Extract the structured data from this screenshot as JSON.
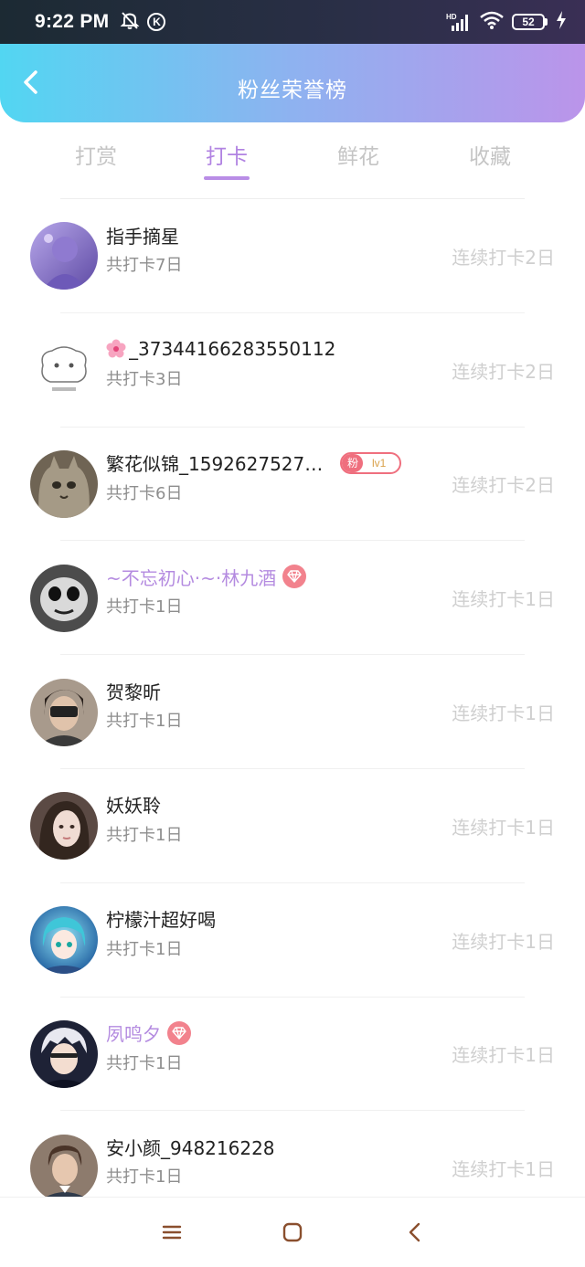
{
  "status_bar": {
    "time": "9:22 PM",
    "k_badge": "K",
    "network_label": "HD",
    "battery": "52",
    "icons": [
      "mute-bell-icon",
      "k-icon",
      "signal-icon",
      "wifi-icon",
      "battery-icon",
      "charging-icon"
    ]
  },
  "header": {
    "title": "粉丝荣誉榜",
    "back_icon": "chevron-left-icon"
  },
  "tabs": [
    {
      "label": "打赏",
      "active": false
    },
    {
      "label": "打卡",
      "active": true
    },
    {
      "label": "鲜花",
      "active": false
    },
    {
      "label": "收藏",
      "active": false
    }
  ],
  "accent_color": "#b183e2",
  "rows": [
    {
      "name": "指手摘星",
      "total": "共打卡7日",
      "streak": "连续打卡2日"
    },
    {
      "name": "_37344166283550112",
      "total": "共打卡3日",
      "streak": "连续打卡2日",
      "name_prefix_icon": "cherry-blossom-icon"
    },
    {
      "name": "繁花似锦_15926275271...",
      "total": "共打卡6日",
      "streak": "连续打卡2日",
      "badge_left": "粉",
      "badge_right": "lv1"
    },
    {
      "name": "~不忘初心·~·林九酒",
      "total": "共打卡1日",
      "streak": "连续打卡1日",
      "vip": true
    },
    {
      "name": "贺黎昕",
      "total": "共打卡1日",
      "streak": "连续打卡1日"
    },
    {
      "name": "妖妖聆",
      "total": "共打卡1日",
      "streak": "连续打卡1日"
    },
    {
      "name": "柠檬汁超好喝",
      "total": "共打卡1日",
      "streak": "连续打卡1日"
    },
    {
      "name": "夙鸣夕",
      "total": "共打卡1日",
      "streak": "连续打卡1日",
      "vip": true
    },
    {
      "name": "安小颜_948216228",
      "total": "共打卡1日",
      "streak": "连续打卡1日"
    }
  ],
  "nav": {
    "icons": [
      "menu-icon",
      "home-square-icon",
      "back-triangle-icon"
    ]
  }
}
